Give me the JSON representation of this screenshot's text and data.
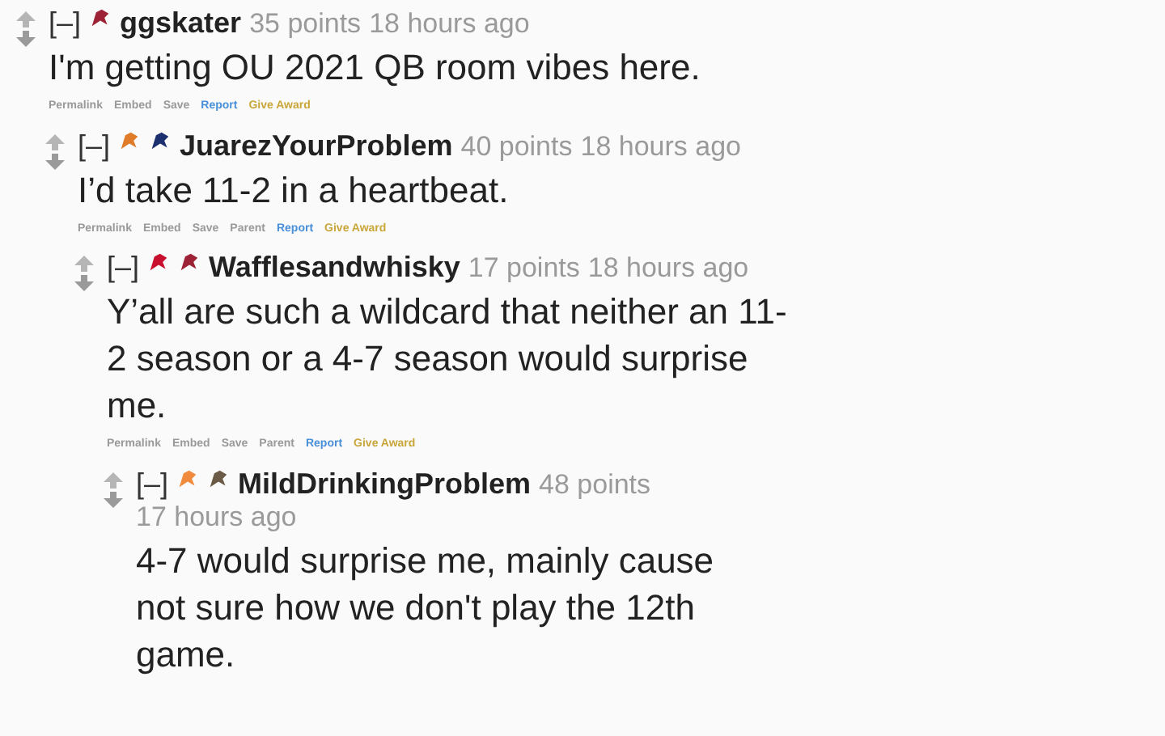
{
  "comments": [
    {
      "collapse": "[–]",
      "flairs": [
        {
          "color": "#9d2235"
        }
      ],
      "author": "ggskater",
      "points": "35 points",
      "time": "18 hours ago",
      "body": "I'm getting OU 2021 QB room vibes here.",
      "actions": [
        {
          "label": "Permalink",
          "kind": "plain"
        },
        {
          "label": "Embed",
          "kind": "plain"
        },
        {
          "label": "Save",
          "kind": "plain"
        },
        {
          "label": "Report",
          "kind": "report"
        },
        {
          "label": "Give Award",
          "kind": "award"
        }
      ],
      "children": [
        {
          "collapse": "[–]",
          "flairs": [
            {
              "color": "#e07b2a"
            },
            {
              "color": "#1c2f6e"
            }
          ],
          "author": "JuarezYourProblem",
          "points": "40 points",
          "time": "18 hours ago",
          "body": "I’d take 11-2 in a heartbeat.",
          "actions": [
            {
              "label": "Permalink",
              "kind": "plain"
            },
            {
              "label": "Embed",
              "kind": "plain"
            },
            {
              "label": "Save",
              "kind": "plain"
            },
            {
              "label": "Parent",
              "kind": "plain"
            },
            {
              "label": "Report",
              "kind": "report"
            },
            {
              "label": "Give Award",
              "kind": "award"
            }
          ],
          "children": [
            {
              "collapse": "[–]",
              "flairs": [
                {
                  "color": "#c8102e"
                },
                {
                  "color": "#9d2235"
                }
              ],
              "author": "Wafflesandwhisky",
              "points": "17 points",
              "time": "18 hours ago",
              "body": "Y’all are such a wildcard that neither an 11-2 season or a 4-7 season would surprise me.",
              "actions": [
                {
                  "label": "Permalink",
                  "kind": "plain"
                },
                {
                  "label": "Embed",
                  "kind": "plain"
                },
                {
                  "label": "Save",
                  "kind": "plain"
                },
                {
                  "label": "Parent",
                  "kind": "plain"
                },
                {
                  "label": "Report",
                  "kind": "report"
                },
                {
                  "label": "Give Award",
                  "kind": "award"
                }
              ],
              "children": [
                {
                  "collapse": "[–]",
                  "flairs": [
                    {
                      "color": "#f08a3c"
                    },
                    {
                      "color": "#6b5a45"
                    }
                  ],
                  "author": "MildDrinkingProblem",
                  "points": "48 points",
                  "time": "17 hours ago",
                  "body": "4-7 would surprise me, mainly cause not sure how we don't play the 12th game."
                }
              ]
            }
          ]
        }
      ]
    }
  ]
}
